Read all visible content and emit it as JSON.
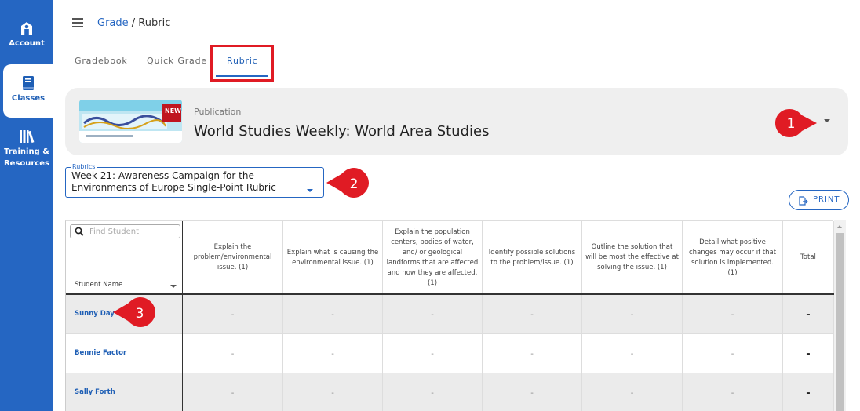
{
  "sidebar": {
    "items": [
      {
        "label": "Account",
        "icon": "account-icon"
      },
      {
        "label": "Classes",
        "icon": "book-icon",
        "active": true
      },
      {
        "label_line1": "Training &",
        "label_line2": "Resources",
        "icon": "library-icon"
      }
    ],
    "color": "#2566c2"
  },
  "breadcrumb": {
    "link": "Grade",
    "separator": " / ",
    "current": "Rubric"
  },
  "tabs": [
    {
      "label": "Gradebook"
    },
    {
      "label": "Quick Grade"
    },
    {
      "label": "Rubric",
      "active": true
    }
  ],
  "publication": {
    "label": "Publication",
    "title": "World Studies Weekly: World Area Studies",
    "image": {
      "badge": "NEW"
    }
  },
  "rubric_select": {
    "legend": "Rubrics",
    "value": "Week 21: Awareness Campaign for the Environments of Europe Single-Point Rubric"
  },
  "print": {
    "label": "PRINT"
  },
  "table": {
    "search_placeholder": "Find Student",
    "student_header": "Student Name",
    "columns": [
      "Explain the problem/environmental issue. (1)",
      "Explain what is causing the environmental issue. (1)",
      "Explain the population centers, bodies of water, and/ or geological landforms that are affected and how they are affected. (1)",
      "Identify possible solutions to the problem/issue. (1)",
      "Outline the solution that will be most the effective at solving the issue. (1)",
      "Detail what positive changes may occur if that solution is implemented. (1)",
      "Total"
    ],
    "rows": [
      {
        "name": "Sunny Day",
        "scores": [
          "-",
          "-",
          "-",
          "-",
          "-",
          "-"
        ],
        "total": "-"
      },
      {
        "name": "Bennie Factor",
        "scores": [
          "-",
          "-",
          "-",
          "-",
          "-",
          "-"
        ],
        "total": "-"
      },
      {
        "name": "Sally Forth",
        "scores": [
          "-",
          "-",
          "-",
          "-",
          "-",
          "-"
        ],
        "total": "-"
      }
    ]
  },
  "callouts": [
    "1",
    "2",
    "3"
  ],
  "colors": {
    "accent": "#2566c2",
    "callout": "#e01b24",
    "row_alt": "#ebebeb"
  }
}
